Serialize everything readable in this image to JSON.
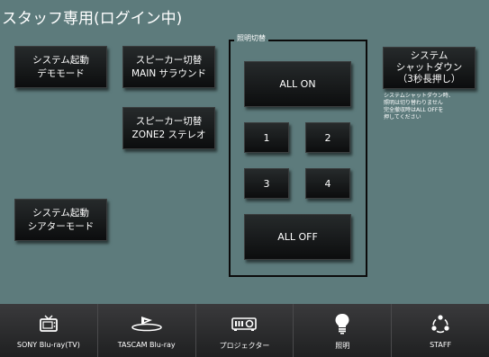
{
  "header": {
    "title": "スタッフ専用(ログイン中)"
  },
  "buttons": {
    "system_start_demo": [
      "システム起動",
      "デモモード"
    ],
    "speaker_main": [
      "スピーカー切替",
      "MAIN サラウンド"
    ],
    "speaker_zone2": [
      "スピーカー切替",
      "ZONE2 ステレオ"
    ],
    "system_start_theater": [
      "システム起動",
      "シアターモード"
    ],
    "shutdown": [
      "システム",
      "シャットダウン",
      "（3秒長押し）"
    ]
  },
  "lighting": {
    "title": "照明切替",
    "all_on": "ALL ON",
    "ch1": "1",
    "ch2": "2",
    "ch3": "3",
    "ch4": "4",
    "all_off": "ALL OFF"
  },
  "shutdown_note": [
    "システムシャットダウン時、",
    "照明は切り替わりません",
    "完全撤収時はALL OFFを",
    "押してください"
  ],
  "tabs": [
    {
      "label": "SONY Blu-ray(TV)",
      "icon": "tv-icon"
    },
    {
      "label": "TASCAM Blu-ray",
      "icon": "bluray-icon"
    },
    {
      "label": "プロジェクター",
      "icon": "projector-icon"
    },
    {
      "label": "照明",
      "icon": "lightbulb-icon"
    },
    {
      "label": "STAFF",
      "icon": "staff-icon"
    }
  ]
}
